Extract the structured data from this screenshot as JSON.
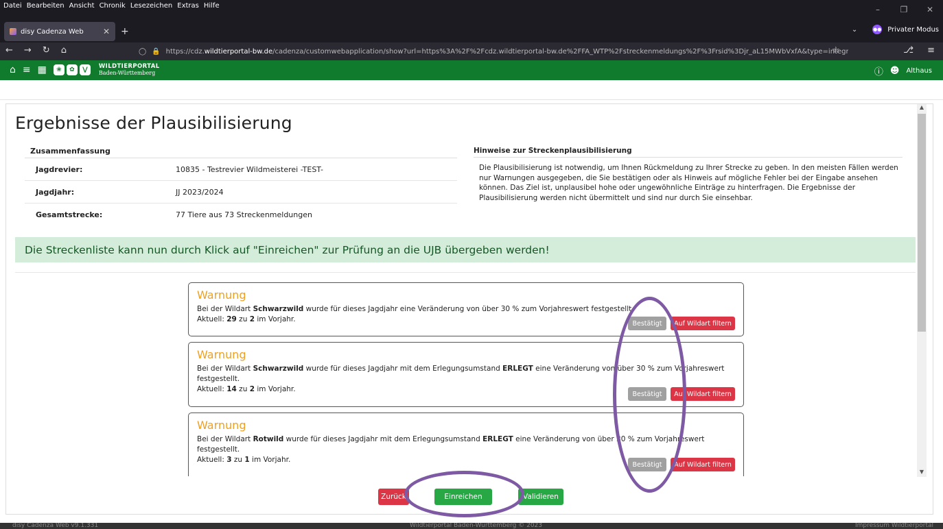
{
  "os_menu": [
    "Datei",
    "Bearbeiten",
    "Ansicht",
    "Chronik",
    "Lesezeichen",
    "Extras",
    "Hilfe"
  ],
  "browser": {
    "tab_title": "disy Cadenza Web",
    "private_label": "Privater Modus",
    "url_prefix": "https://cdz.",
    "url_host": "wildtierportal-bw.de",
    "url_path": "/cadenza/customwebapplication/show?url=https%3A%2F%2Fcdz.wildtierportal-bw.de%2FFA_WTP%2Fstreckenmeldungs%2F%3Frsid%3Djr_aL15MWbVxfA&type=integration&applicationId=FA"
  },
  "app_header": {
    "brand_line1": "WILDTIERPORTAL",
    "brand_line2": "Baden-Württemberg",
    "user": "Althaus"
  },
  "page": {
    "title": "Ergebnisse der Plausibilisierung",
    "summary": {
      "heading": "Zusammenfassung",
      "rows": [
        {
          "label": "Jagdrevier:",
          "value": "10835 - Testrevier Wildmeisterei -TEST-"
        },
        {
          "label": "Jagdjahr:",
          "value": "JJ 2023/2024"
        },
        {
          "label": "Gesamtstrecke:",
          "value": "77 Tiere aus 73 Streckenmeldungen"
        }
      ]
    },
    "hints": {
      "heading": "Hinweise zur Streckenplausibilisierung",
      "text": "Die Plausibilisierung ist notwendig, um Ihnen Rückmeldung zu Ihrer Strecke zu geben. In den meisten Fällen werden nur Warnungen ausgegeben, die Sie bestätigen oder als Hinweis auf mögliche Fehler bei der Eingabe ansehen können. Das Ziel ist, unplausibel hohe oder ungewöhnliche Einträge zu hinterfragen. Die Ergebnisse der Plausibilisierung werden nicht übermittelt und sind nur durch Sie einsehbar."
    },
    "success_message": "Die Streckenliste kann nun durch Klick auf \"Einreichen\" zur Prüfung an die UJB übergeben werden!",
    "warnings": [
      {
        "title": "Warnung",
        "t1": "Bei der Wildart ",
        "species": "Schwarzwild",
        "t2": " wurde für dieses Jagdjahr eine Veränderung von über 30 % zum Vorjahreswert festgestellt.",
        "umstand_prefix": "",
        "umstand": "",
        "umstand_suffix": "",
        "aktuell": "Aktuell: ",
        "current": "29",
        "zu": " zu ",
        "previous": "2",
        "vorjahr": " im Vorjahr.",
        "confirm_label": "Bestätigt",
        "filter_label": "Auf Wildart filtern"
      },
      {
        "title": "Warnung",
        "t1": "Bei der Wildart ",
        "species": "Schwarzwild",
        "t2": " wurde für dieses Jagdjahr mit dem Erlegungsumstand ",
        "umstand": "ERLEGT",
        "umstand_suffix": " eine Veränderung von über 30 % zum Vorjahreswert festgestellt.",
        "aktuell": "Aktuell: ",
        "current": "14",
        "zu": " zu ",
        "previous": "2",
        "vorjahr": " im Vorjahr.",
        "confirm_label": "Bestätigt",
        "filter_label": "Auf Wildart filtern"
      },
      {
        "title": "Warnung",
        "t1": "Bei der Wildart ",
        "species": "Rotwild",
        "t2": " wurde für dieses Jagdjahr mit dem Erlegungsumstand ",
        "umstand": "ERLEGT",
        "umstand_suffix": " eine Veränderung von über 30 % zum Vorjahreswert festgestellt.",
        "aktuell": "Aktuell: ",
        "current": "3",
        "zu": " zu ",
        "previous": "1",
        "vorjahr": " im Vorjahr.",
        "confirm_label": "Bestätigt",
        "filter_label": "Auf Wildart filtern"
      }
    ],
    "actions": {
      "back_label": "Zurück",
      "submit_label": "Einreichen",
      "validate_label": "Validieren"
    }
  },
  "footer": {
    "left": "disy Cadenza Web v9.1.331",
    "center": "Wildtierportal Baden-Württemberg © 2023",
    "right": "Impressum Wildtierportal"
  },
  "colors": {
    "header_green": "#107a2d",
    "warning_orange": "#f0a020",
    "danger_red": "#dc3545",
    "success_green": "#28a745",
    "annotation_purple": "#7e5aa4"
  }
}
